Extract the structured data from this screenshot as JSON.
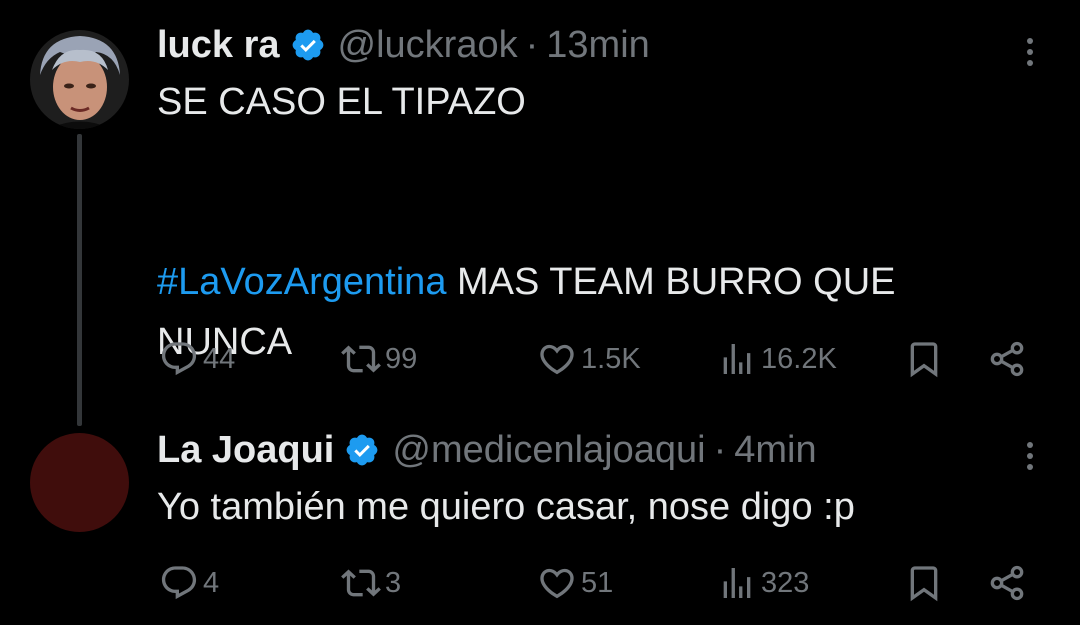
{
  "colors": {
    "background": "#000000",
    "text": "#e7e9ea",
    "secondary": "#71767b",
    "hashtag": "#1d9bf0",
    "verified": "#1d9bf0"
  },
  "tweets": [
    {
      "name": "luck ra",
      "handle": "@luckraok",
      "separator": "·",
      "time": "13min",
      "text_line1": "SE CASO EL TIPAZO",
      "hashtag": "#LaVozArgentina",
      "text_rest": " MAS TEAM BURRO QUE\nNUNCA",
      "stats": {
        "replies": "44",
        "retweets": "99",
        "likes": "1.5K",
        "views": "16.2K"
      }
    },
    {
      "name": "La Joaqui",
      "handle": "@medicenlajoaqui",
      "separator": "·",
      "time": "4min",
      "text": "Yo también me quiero casar, nose digo :p",
      "stats": {
        "replies": "4",
        "retweets": "3",
        "likes": "51",
        "views": "323"
      }
    }
  ]
}
